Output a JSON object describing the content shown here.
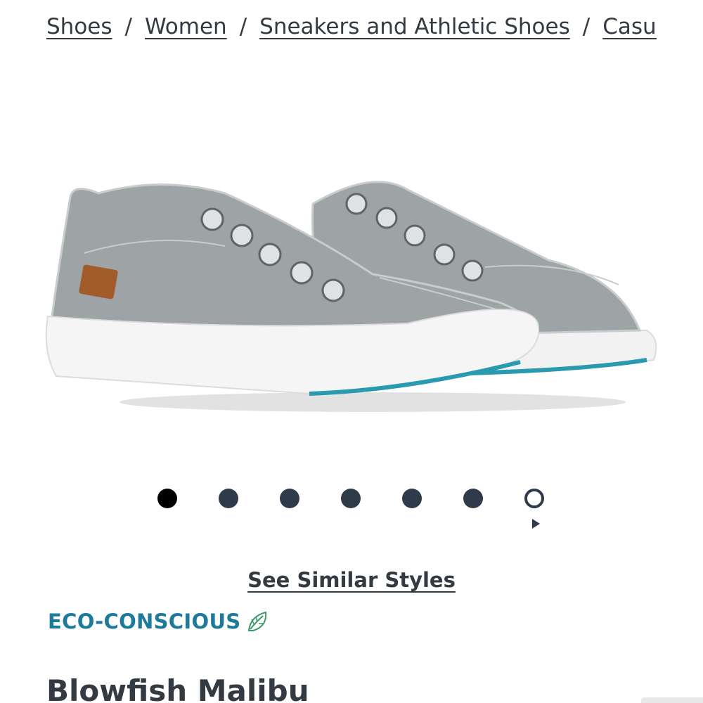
{
  "breadcrumb": {
    "items": [
      "Shoes",
      "Women",
      "Sneakers and Athletic Shoes",
      "Casual"
    ],
    "separator": "/"
  },
  "product": {
    "image_icon": "sneaker-product-image",
    "similar_link": "See Similar Styles",
    "eco_label": "ECO-CONSCIOUS",
    "eco_icon": "leaf-icon",
    "name": "Blowfish Malibu"
  },
  "carousel": {
    "total_dots": 7,
    "active_index": 0,
    "next_icon": "play-arrow-icon"
  },
  "colors": {
    "text": "#333a42",
    "eco": "#1d7a9a",
    "dot": "#2f3b4a",
    "dot_active": "#000000",
    "sole_accent": "#2a9ab0"
  }
}
